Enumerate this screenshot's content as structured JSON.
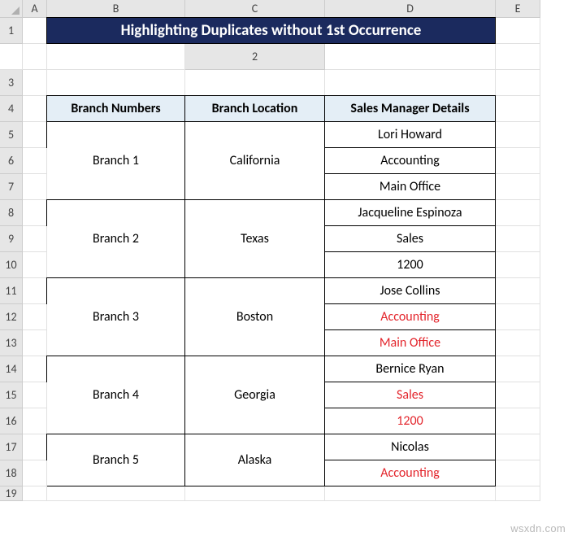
{
  "columns": [
    "A",
    "B",
    "C",
    "D",
    "E"
  ],
  "rows": [
    "1",
    "2",
    "3",
    "4",
    "5",
    "6",
    "7",
    "8",
    "9",
    "10",
    "11",
    "12",
    "13",
    "14",
    "15",
    "16",
    "17",
    "18",
    "19"
  ],
  "title": "Highlighting Duplicates without 1st Occurrence",
  "headers": {
    "branch_numbers": "Branch Numbers",
    "branch_location": "Branch Location",
    "sales_manager": "Sales Manager Details"
  },
  "branches": [
    {
      "number": "Branch 1",
      "location": "California",
      "details": [
        "Lori Howard",
        "Accounting",
        "Main Office"
      ],
      "highlight": [
        false,
        false,
        false
      ]
    },
    {
      "number": "Branch 2",
      "location": "Texas",
      "details": [
        "Jacqueline Espinoza",
        "Sales",
        "1200"
      ],
      "highlight": [
        false,
        false,
        false
      ]
    },
    {
      "number": "Branch 3",
      "location": "Boston",
      "details": [
        "Jose Collins",
        "Accounting",
        "Main Office"
      ],
      "highlight": [
        false,
        true,
        true
      ]
    },
    {
      "number": "Branch 4",
      "location": "Georgia",
      "details": [
        "Bernice Ryan",
        "Sales",
        "1200"
      ],
      "highlight": [
        false,
        true,
        true
      ]
    },
    {
      "number": "Branch 5",
      "location": "Alaska",
      "details": [
        "Nicolas",
        "Accounting"
      ],
      "highlight": [
        false,
        true
      ]
    }
  ],
  "watermark": "wsxdn.com"
}
